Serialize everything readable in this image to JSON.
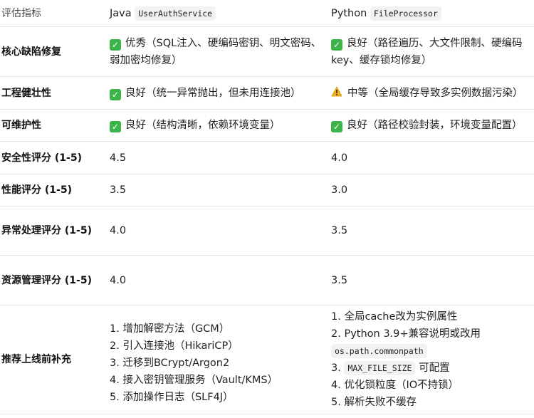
{
  "header": {
    "metric": "评估指标",
    "java_lang": "Java",
    "java_class": "UserAuthService",
    "python_lang": "Python",
    "python_class": "FileProcessor"
  },
  "rows": [
    {
      "metric": "核心缺陷修复",
      "java": {
        "icon": "check-icon",
        "text": "优秀（SQL注入、硬编码密钥、明文密码、弱加密均修复）"
      },
      "python": {
        "icon": "check-icon",
        "text": "良好（路径遍历、大文件限制、硬编码key、缓存锁均修复）"
      }
    },
    {
      "metric": "工程健壮性",
      "java": {
        "icon": "check-icon",
        "text": "良好（统一异常抛出，但未用连接池）"
      },
      "python": {
        "icon": "warning-icon",
        "text": "中等（全局缓存导致多实例数据污染）"
      }
    },
    {
      "metric": "可维护性",
      "java": {
        "icon": "check-icon",
        "text": "良好（结构清晰，依赖环境变量）"
      },
      "python": {
        "icon": "check-icon",
        "text": "良好（路径校验封装，环境变量配置）"
      }
    },
    {
      "metric": "安全性评分 (1-5)",
      "java": "4.5",
      "python": "4.0"
    },
    {
      "metric": "性能评分 (1-5)",
      "java": "3.5",
      "python": "3.0"
    },
    {
      "metric": "异常处理评分 (1-5)",
      "java": "4.0",
      "python": "3.5"
    },
    {
      "metric": "资源管理评分 (1-5)",
      "java": "4.0",
      "python": "3.5"
    }
  ],
  "recommendations": {
    "metric": "推荐上线前补充",
    "java": [
      "1. 增加解密方法（GCM）",
      "2. 引入连接池（HikariCP）",
      "3. 迁移到BCrypt/Argon2",
      "4. 接入密钥管理服务（Vault/KMS）",
      "5. 添加操作日志（SLF4J）"
    ],
    "python": {
      "item1": "1. 全局cache改为实例属性",
      "item2_prefix": "2. Python 3.9+兼容说明或改用",
      "item2_code": "os.path.commonpath",
      "item3_prefix": "3.",
      "item3_code": "MAX_FILE_SIZE",
      "item3_suffix": "可配置",
      "item4": "4. 优化锁粒度（IO不持锁）",
      "item5": "5. 解析失败不缓存"
    }
  },
  "colors": {
    "check": "#3bb54a",
    "warning": "#f2b01e",
    "border": "#e6e6e6"
  }
}
